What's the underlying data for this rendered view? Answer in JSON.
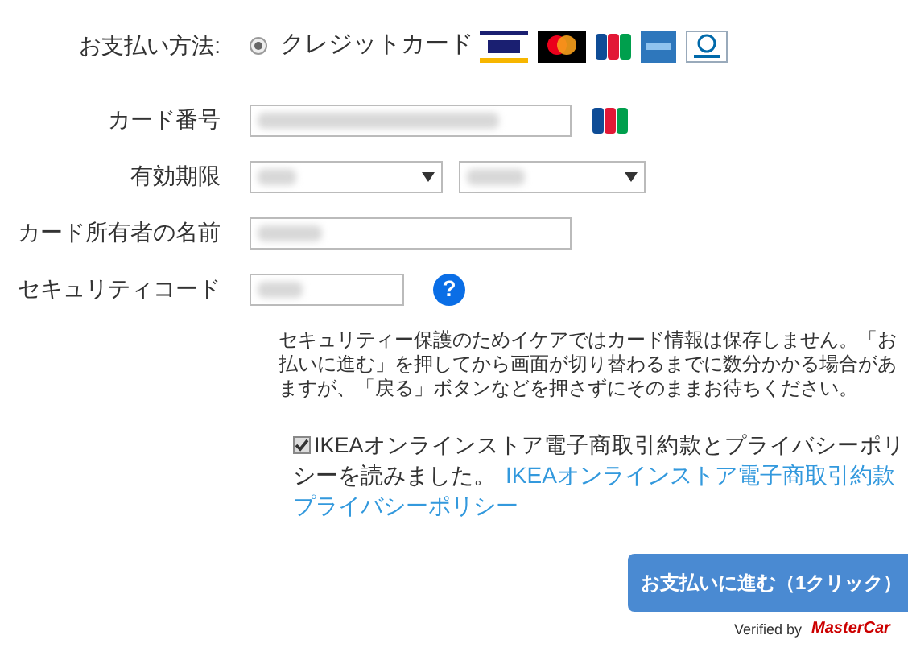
{
  "payment_method": {
    "label": "お支払い方法:",
    "options": [
      {
        "label": "クレジットカード",
        "selected": true
      }
    ]
  },
  "fields": [
    {
      "kind": "text",
      "label": "カード番号",
      "card_icon": true
    },
    {
      "kind": "selects",
      "label": "有効期限"
    },
    {
      "kind": "text",
      "label": "カード所有者の名前",
      "card_icon": false
    },
    {
      "kind": "short",
      "label": "セキュリティコード",
      "help": "?"
    }
  ],
  "notice": [
    "セキュリティー保護のためイケアではカード情報は保存しません。「お",
    "払いに進む」を押してから画面が切り替わるまでに数分かかる場合があ",
    "ますが、「戻る」ボタンなどを押さずにそのままお待ちください。"
  ],
  "agreement": {
    "checked": true,
    "text": "IKEAオンラインストア電子商取引約款とプライバシーポリシーを読みました。",
    "links": [
      "IKEAオンラインストア電子商取引約款",
      "プライバシーポリシー"
    ]
  },
  "submit": "お支払いに進む（1クリック）",
  "verified": {
    "prefix": "Verified by",
    "brand": "MasterCar"
  }
}
